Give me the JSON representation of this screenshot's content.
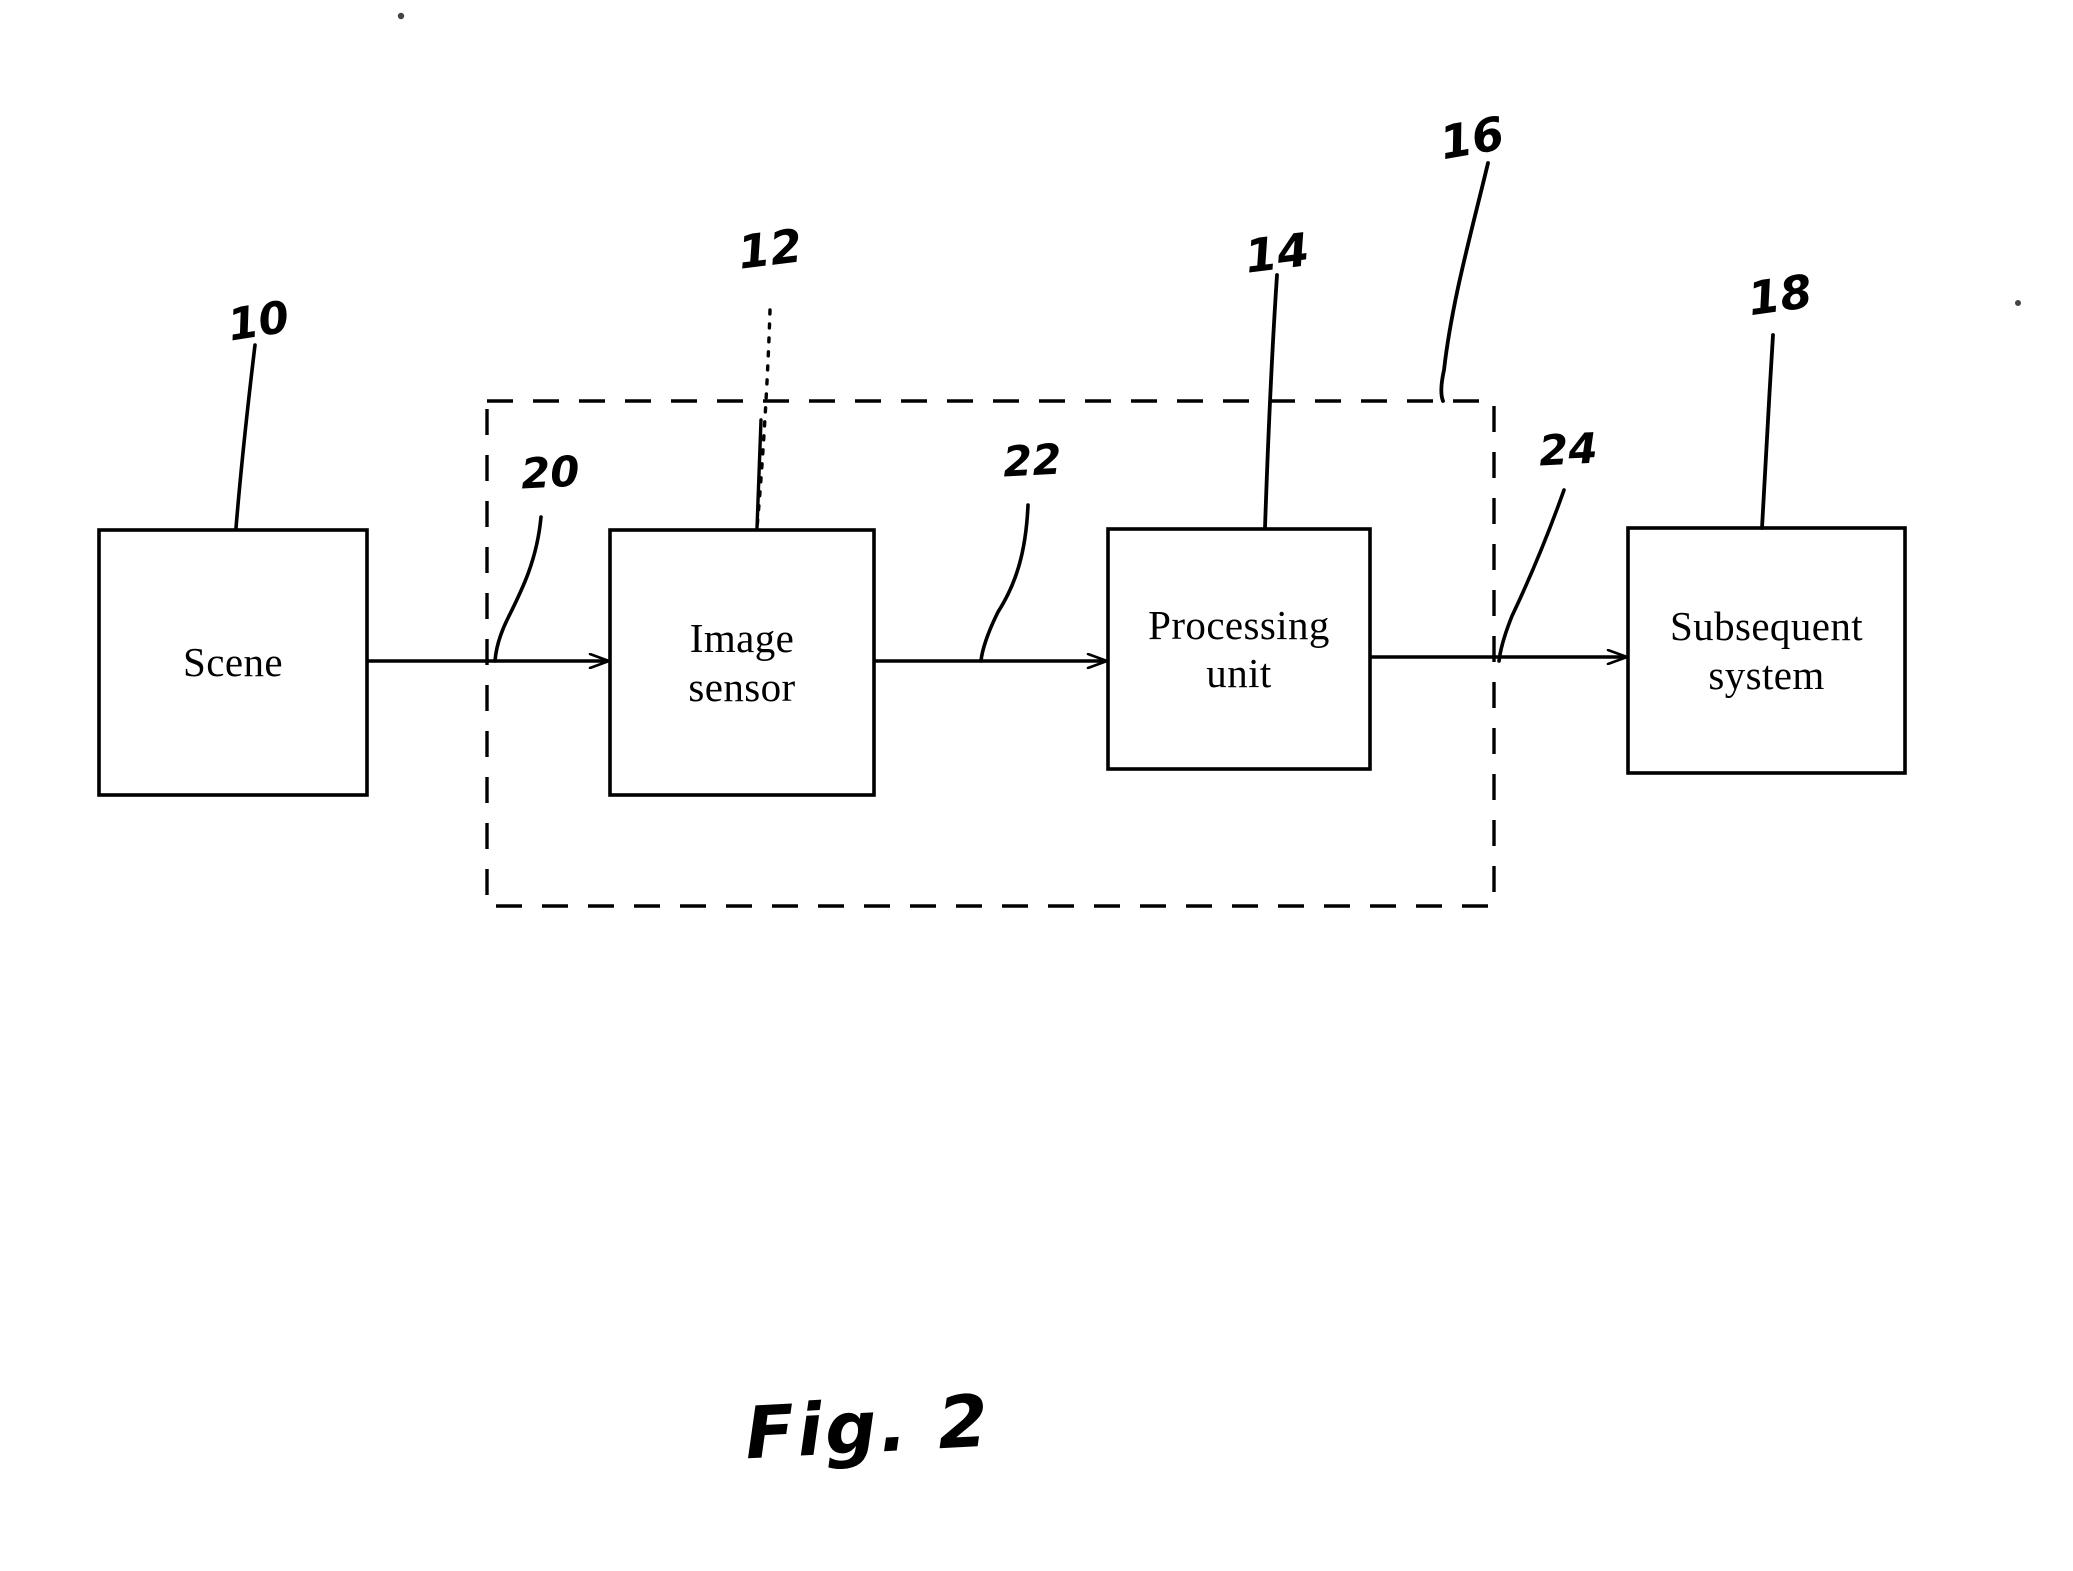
{
  "figure": {
    "caption": "Fig. 2",
    "type": "patent-block-diagram",
    "background_color": "#ffffff",
    "ink_color": "#000000"
  },
  "blocks": [
    {
      "id": "scene",
      "label_line1": "Scene",
      "label_line2": "",
      "ref": "10"
    },
    {
      "id": "image-sensor",
      "label_line1": "Image",
      "label_line2": "sensor",
      "ref": "12"
    },
    {
      "id": "processing-unit",
      "label_line1": "Processing",
      "label_line2": "unit",
      "ref": "14"
    },
    {
      "id": "subsequent-system",
      "label_line1": "Subsequent",
      "label_line2": "system",
      "ref": "18"
    }
  ],
  "enclosure": {
    "id": "camera-module",
    "ref": "16",
    "style": "dashed"
  },
  "connections": [
    {
      "id": "scene-to-sensor",
      "ref": "20"
    },
    {
      "id": "sensor-to-processing",
      "ref": "22"
    },
    {
      "id": "processing-to-subsequent",
      "ref": "24"
    }
  ],
  "reference_numerals": {
    "n10": "10",
    "n12": "12",
    "n14": "14",
    "n16": "16",
    "n18": "18",
    "n20": "20",
    "n22": "22",
    "n24": "24"
  }
}
